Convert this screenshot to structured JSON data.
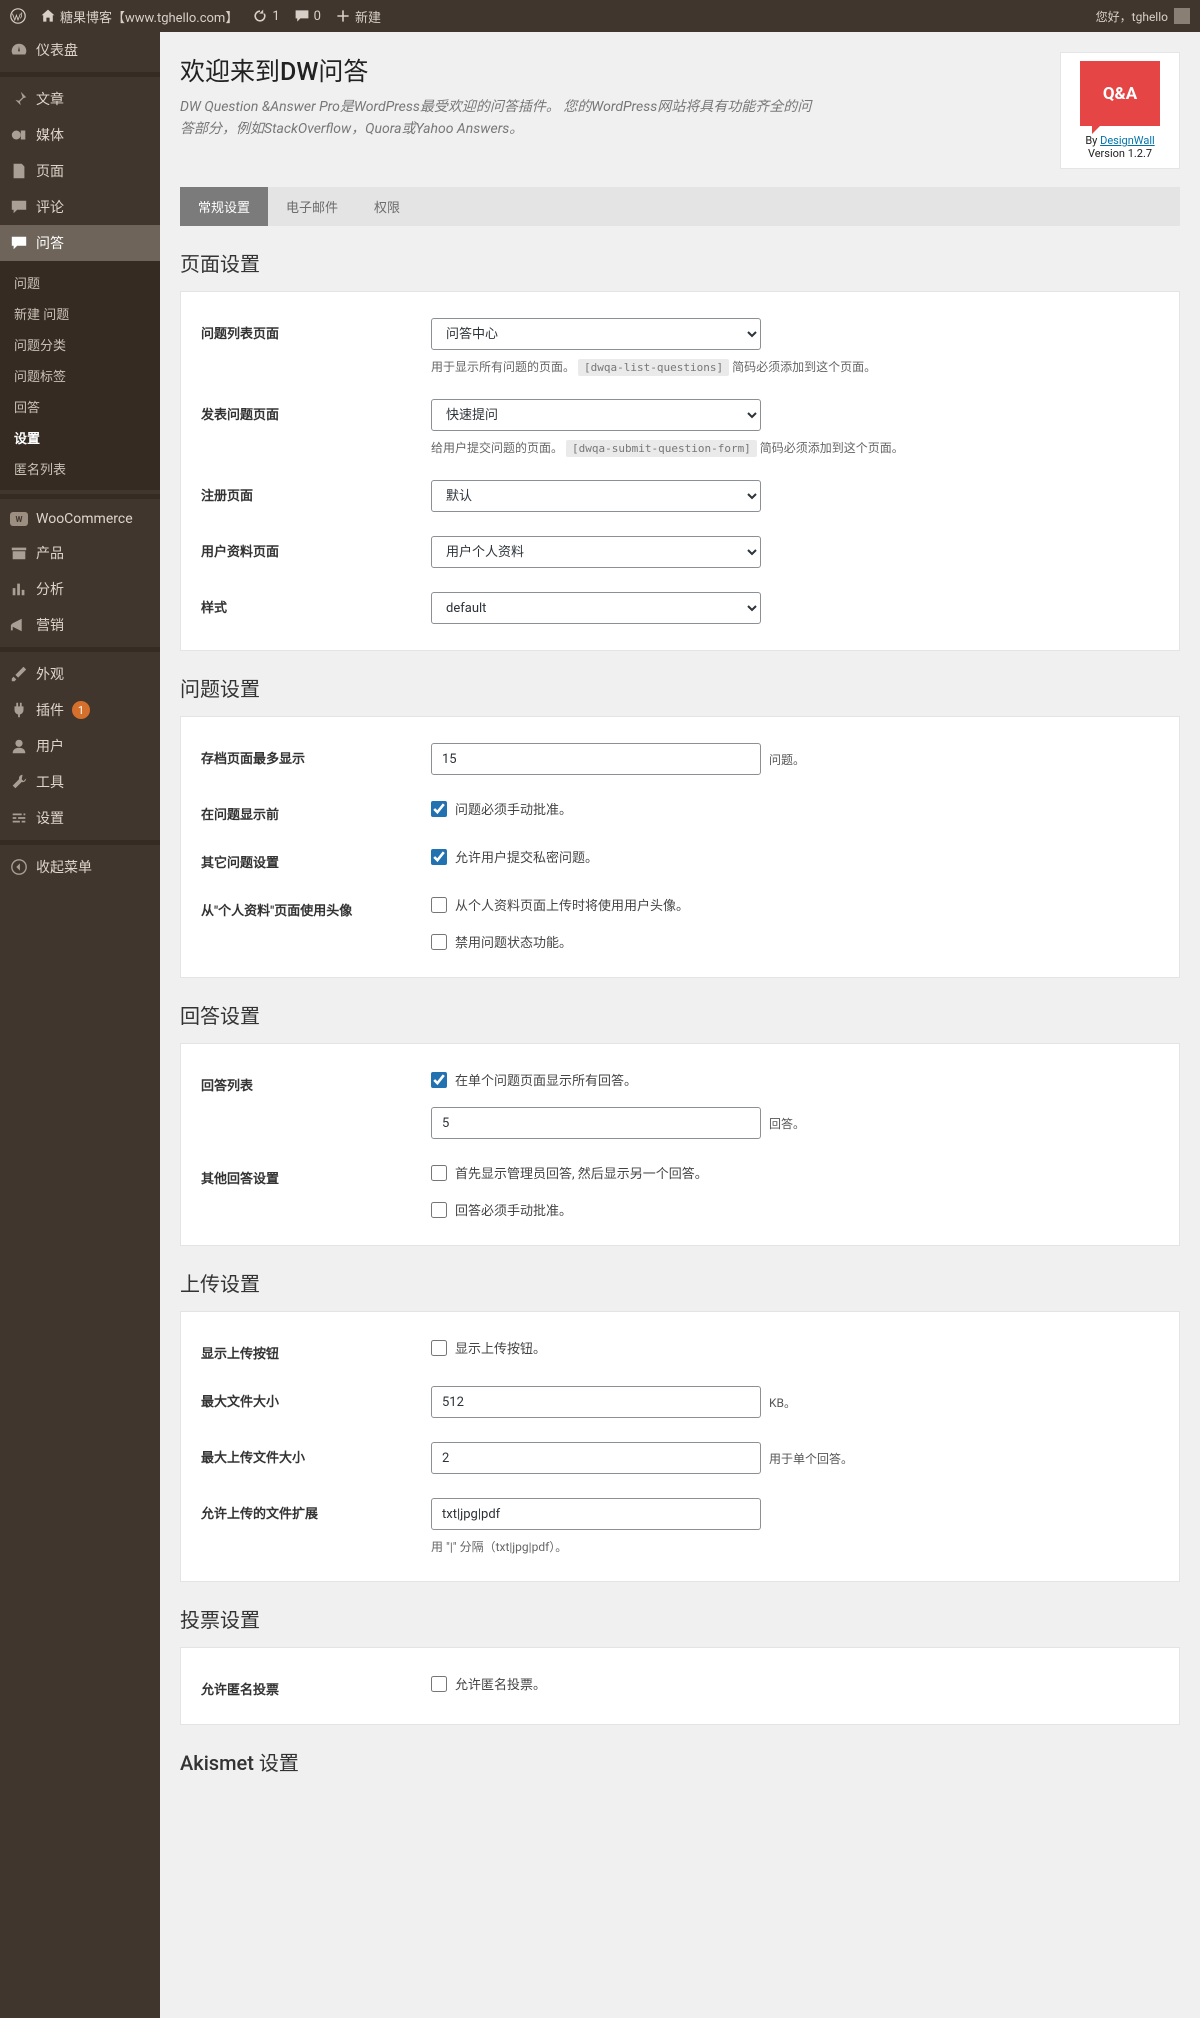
{
  "toolbar": {
    "site": "糖果博客【www.tghello.com】",
    "updates": "1",
    "comments": "0",
    "new": "新建",
    "greeting": "您好，tghello"
  },
  "menu": {
    "dashboard": "仪表盘",
    "posts": "文章",
    "media": "媒体",
    "pages": "页面",
    "comments": "评论",
    "qa": "问答",
    "sub": {
      "questions": "问题",
      "new_q": "新建 问题",
      "q_cat": "问题分类",
      "q_tag": "问题标签",
      "answers": "回答",
      "settings": "设置",
      "anon": "匿名列表"
    },
    "woo": "WooCommerce",
    "products": "产品",
    "analytics": "分析",
    "marketing": "营销",
    "appearance": "外观",
    "plugins": "插件",
    "plugins_badge": "1",
    "users": "用户",
    "tools": "工具",
    "settings2": "设置",
    "collapse": "收起菜单"
  },
  "header": {
    "title": "欢迎来到DW问答",
    "desc": "DW Question &Answer Pro是WordPress最受欢迎的问答插件。 您的WordPress网站将具有功能齐全的问答部分，例如StackOverflow，Quora或Yahoo Answers。",
    "by": "By",
    "author": "DesignWall",
    "version": "Version 1.2.7",
    "logo": "Q&A"
  },
  "tabs": {
    "general": "常规设置",
    "email": "电子邮件",
    "perm": "权限"
  },
  "sections": {
    "page": "页面设置",
    "question": "问题设置",
    "answer": "回答设置",
    "upload": "上传设置",
    "vote": "投票设置",
    "akismet": "Akismet 设置"
  },
  "fields": {
    "q_list": {
      "label": "问题列表页面",
      "value": "问答中心",
      "help1": "用于显示所有问题的页面。",
      "code": "[dwqa-list-questions]",
      "help2": "简码必须添加到这个页面。"
    },
    "q_submit": {
      "label": "发表问题页面",
      "value": "快速提问",
      "help1": "给用户提交问题的页面。",
      "code": "[dwqa-submit-question-form]",
      "help2": "简码必须添加到这个页面。"
    },
    "register": {
      "label": "注册页面",
      "value": "默认"
    },
    "profile": {
      "label": "用户资料页面",
      "value": "用户个人资料"
    },
    "style": {
      "label": "样式",
      "value": "default"
    },
    "archive_max": {
      "label": "存档页面最多显示",
      "value": "15",
      "suffix": "问题。"
    },
    "before_show": {
      "label": "在问题显示前",
      "chk": "问题必须手动批准。"
    },
    "other_q": {
      "label": "其它问题设置",
      "chk": "允许用户提交私密问题。"
    },
    "avatar_src": {
      "label": "从\"个人资料\"页面使用头像",
      "chk1": "从个人资料页面上传时将使用用户头像。",
      "chk2": "禁用问题状态功能。"
    },
    "ans_list": {
      "label": "回答列表",
      "chk": "在单个问题页面显示所有回答。",
      "value": "5",
      "suffix": "回答。"
    },
    "other_a": {
      "label": "其他回答设置",
      "chk1": "首先显示管理员回答, 然后显示另一个回答。",
      "chk2": "回答必须手动批准。"
    },
    "show_upload": {
      "label": "显示上传按钮",
      "chk": "显示上传按钮。"
    },
    "max_file": {
      "label": "最大文件大小",
      "value": "512",
      "suffix": "KB。"
    },
    "max_upload": {
      "label": "最大上传文件大小",
      "value": "2",
      "suffix": "用于单个回答。"
    },
    "allowed_ext": {
      "label": "允许上传的文件扩展",
      "value": "txt|jpg|pdf",
      "help": "用 \"|\" 分隔（txt|jpg|pdf）。"
    },
    "anon_vote": {
      "label": "允许匿名投票",
      "chk": "允许匿名投票。"
    }
  }
}
